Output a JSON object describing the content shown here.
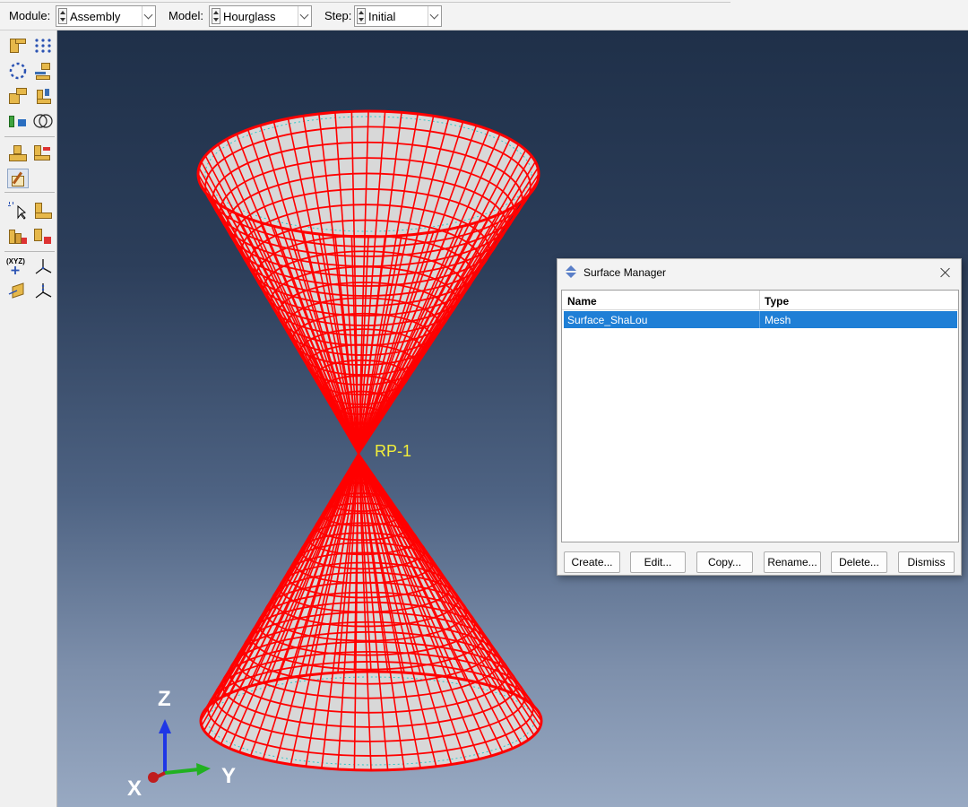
{
  "context_bar": {
    "module_label": "Module:",
    "module_value": "Assembly",
    "model_label": "Model:",
    "model_value": "Hourglass",
    "step_label": "Step:",
    "step_value": "Initial"
  },
  "toolbox": {
    "xyz_text": "(XYZ)"
  },
  "viewport": {
    "reference_point_label": "RP-1",
    "triad": {
      "z": "Z",
      "y": "Y",
      "x": "X"
    },
    "colors": {
      "mesh": "#ff0000",
      "surface": "#d8d8d8",
      "inner_edges": "#2ec8c8",
      "rp_label": "#f2ee3a"
    }
  },
  "dialog": {
    "title": "Surface Manager",
    "columns": [
      "Name",
      "Type"
    ],
    "rows": [
      {
        "name": "Surface_ShaLou",
        "type": "Mesh",
        "selected": true
      }
    ],
    "buttons": [
      "Create...",
      "Edit...",
      "Copy...",
      "Rename...",
      "Delete...",
      "Dismiss"
    ],
    "selection_color": "#1f7fd6"
  }
}
